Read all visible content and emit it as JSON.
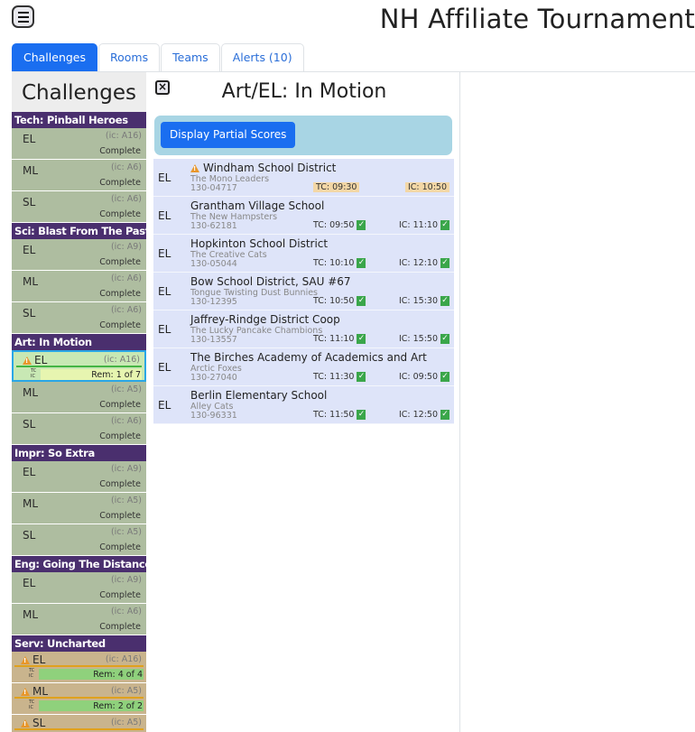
{
  "header": {
    "title": "NH Affiliate Tournament"
  },
  "tabs": [
    {
      "label": "Challenges",
      "active": true
    },
    {
      "label": "Rooms",
      "active": false
    },
    {
      "label": "Teams",
      "active": false
    },
    {
      "label": "Alerts (10)",
      "active": false
    }
  ],
  "left": {
    "title": "Challenges",
    "groups": [
      {
        "name": "Tech: Pinball Heroes",
        "cells": [
          {
            "div": "EL",
            "ic": "(ic: A16)",
            "status": "Complete"
          },
          {
            "div": "ML",
            "ic": "(ic: A6)",
            "status": "Complete"
          },
          {
            "div": "SL",
            "ic": "(ic: A6)",
            "status": "Complete"
          }
        ]
      },
      {
        "name": "Sci: Blast From The Past",
        "cells": [
          {
            "div": "EL",
            "ic": "(ic: A9)",
            "status": "Complete"
          },
          {
            "div": "ML",
            "ic": "(ic: A6)",
            "status": "Complete"
          },
          {
            "div": "SL",
            "ic": "(ic: A6)",
            "status": "Complete"
          }
        ]
      },
      {
        "name": "Art: In Motion",
        "cells": [
          {
            "div": "EL",
            "ic": "(ic: A16)",
            "rem": "Rem: 1 of 7",
            "tc": "TC",
            "icl": "IC"
          },
          {
            "div": "ML",
            "ic": "(ic: A5)",
            "status": "Complete"
          },
          {
            "div": "SL",
            "ic": "(ic: A6)",
            "status": "Complete"
          }
        ]
      },
      {
        "name": "Impr: So Extra",
        "cells": [
          {
            "div": "EL",
            "ic": "(ic: A9)",
            "status": "Complete"
          },
          {
            "div": "ML",
            "ic": "(ic: A5)",
            "status": "Complete"
          },
          {
            "div": "SL",
            "ic": "(ic: A5)",
            "status": "Complete"
          }
        ]
      },
      {
        "name": "Eng: Going The Distance",
        "cells": [
          {
            "div": "EL",
            "ic": "(ic: A9)",
            "status": "Complete"
          },
          {
            "div": "ML",
            "ic": "(ic: A6)",
            "status": "Complete"
          }
        ]
      },
      {
        "name": "Serv: Uncharted",
        "cells": [
          {
            "div": "EL",
            "ic": "(ic: A16)",
            "rem": "Rem: 4 of 4",
            "tc": "TC",
            "icl": "IC"
          },
          {
            "div": "ML",
            "ic": "(ic: A5)",
            "rem": "Rem: 2 of 2",
            "tc": "TC",
            "icl": "IC"
          },
          {
            "div": "SL",
            "ic": "(ic: A5)"
          }
        ]
      }
    ]
  },
  "middle": {
    "close_icon": "×",
    "title": "Art/EL: In Motion",
    "partial_button": "Display Partial Scores",
    "teams": [
      {
        "div": "EL",
        "name": "Windham School District",
        "sub": "The Mono Leaders",
        "num": "130-04717",
        "tc": "TC: 09:30",
        "ic": "IC: 10:50",
        "warn": true
      },
      {
        "div": "EL",
        "name": "Grantham Village School",
        "sub": "The New Hampsters",
        "num": "130-62181",
        "tc": "TC: 09:50",
        "ic": "IC: 11:10"
      },
      {
        "div": "EL",
        "name": "Hopkinton School District",
        "sub": "The Creative Cats",
        "num": "130-05044",
        "tc": "TC: 10:10",
        "ic": "IC: 12:10"
      },
      {
        "div": "EL",
        "name": "Bow School District, SAU #67",
        "sub": "Tongue Twisting Dust Bunnies",
        "num": "130-12395",
        "tc": "TC: 10:50",
        "ic": "IC: 15:30"
      },
      {
        "div": "EL",
        "name": "Jaffrey-Rindge District Coop",
        "sub": "The Lucky Pancake Chambions",
        "num": "130-13557",
        "tc": "TC: 11:10",
        "ic": "IC: 15:50"
      },
      {
        "div": "EL",
        "name": "The Birches Academy of Academics and Art",
        "sub": "Arctic Foxes",
        "num": "130-27040",
        "tc": "TC: 11:30",
        "ic": "IC: 09:50"
      },
      {
        "div": "EL",
        "name": "Berlin Elementary School",
        "sub": "Alley Cats",
        "num": "130-96331",
        "tc": "TC: 11:50",
        "ic": "IC: 12:50"
      }
    ]
  },
  "colors": {
    "accent": "#1a6ef0",
    "group_header": "#4a2f6e",
    "cell_complete": "#aebda0",
    "cell_warn": "#c9b48d",
    "team_row": "#dee4f9"
  }
}
